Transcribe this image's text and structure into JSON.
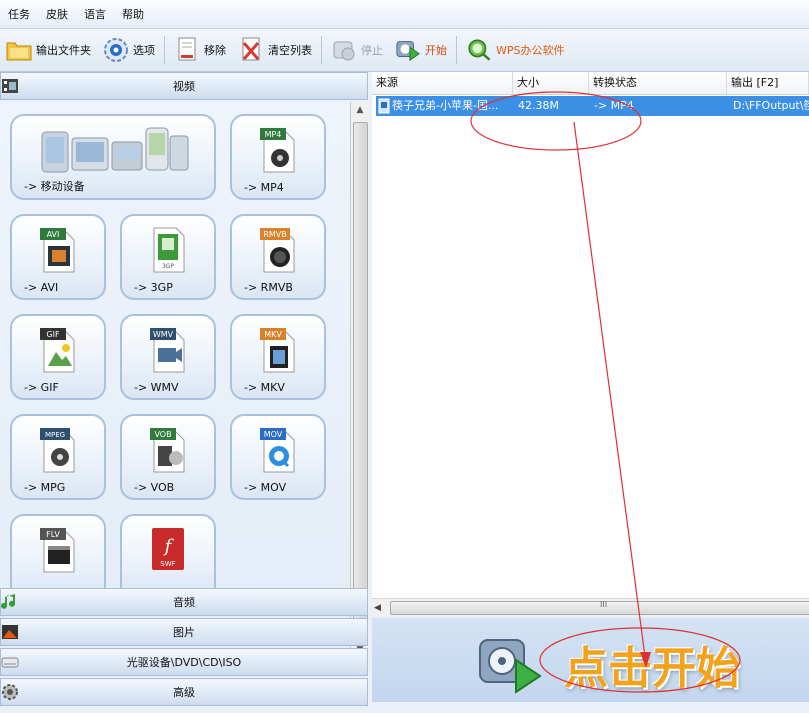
{
  "menu": [
    "任务",
    "皮肤",
    "语言",
    "帮助"
  ],
  "toolbar": {
    "output_folder": "输出文件夹",
    "options": "选项",
    "remove": "移除",
    "clear_list": "清空列表",
    "stop": "停止",
    "start": "开始",
    "wps": "WPS办公软件"
  },
  "categories": {
    "video": "视频",
    "audio": "音频",
    "image": "图片",
    "optical": "光驱设备\\DVD\\CD\\ISO",
    "advanced": "高级"
  },
  "formats": [
    {
      "label": "-> 移动设备",
      "icon": "mobile-devices-icon"
    },
    {
      "label": "-> MP4",
      "icon": "mp4-file-icon",
      "badge": "MP4"
    },
    {
      "label": "-> AVI",
      "icon": "avi-file-icon",
      "badge": "AVI"
    },
    {
      "label": "-> 3GP",
      "icon": "3gp-file-icon",
      "badge": "3GP"
    },
    {
      "label": "-> RMVB",
      "icon": "rmvb-file-icon",
      "badge": "RMVB"
    },
    {
      "label": "-> GIF",
      "icon": "gif-file-icon",
      "badge": "GIF"
    },
    {
      "label": "-> WMV",
      "icon": "wmv-file-icon",
      "badge": "WMV"
    },
    {
      "label": "-> MKV",
      "icon": "mkv-file-icon",
      "badge": "MKV"
    },
    {
      "label": "-> MPG",
      "icon": "mpg-file-icon",
      "badge": "MPEG"
    },
    {
      "label": "-> VOB",
      "icon": "vob-file-icon",
      "badge": "VOB"
    },
    {
      "label": "-> MOV",
      "icon": "mov-file-icon",
      "badge": "MOV"
    },
    {
      "label": "",
      "icon": "flv-file-icon",
      "badge": "FLV"
    },
    {
      "label": "",
      "icon": "swf-file-icon",
      "badge": "SWF"
    }
  ],
  "table": {
    "headers": {
      "source": "来源",
      "size": "大小",
      "status": "转换状态",
      "output": "输出 [F2]"
    },
    "rows": [
      {
        "source": "筷子兄弟-小苹果-国...",
        "size": "42.38M",
        "status": "-> MP4",
        "output": "D:\\FFOutput\\筷"
      }
    ]
  },
  "scroll_grip": "III",
  "start_button": "点击开始",
  "colors": {
    "selected_row": "#3b8fe4",
    "start_text": "#f3a21c",
    "annotation": "#e03131"
  }
}
